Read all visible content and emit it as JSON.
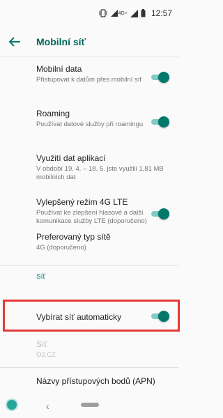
{
  "status_bar": {
    "network": "4G+",
    "time": "12:57"
  },
  "app_bar": {
    "title": "Mobilní síť"
  },
  "settings": {
    "mobile_data": {
      "title": "Mobilní data",
      "summary": "Přistupovat k datům přes mobilní síť",
      "on": true
    },
    "roaming": {
      "title": "Roaming",
      "summary": "Používat datové služby při roamingu",
      "on": true
    },
    "data_usage": {
      "title": "Využití dat aplikací",
      "summary": "V období 19. 4. – 18. 5. jste využili 1,81 MB mobilních dat"
    },
    "lte": {
      "title": "Vylepšený režim 4G LTE",
      "summary": "Používat ke zlepšení hlasové a další komunikace služby LTE (doporučeno)",
      "on": true
    },
    "network_type": {
      "title": "Preferovaný typ sítě",
      "summary": "4G (doporučeno)"
    }
  },
  "network_section": {
    "header": "Síť",
    "auto_select": {
      "title": "Vybírat síť automaticky",
      "on": true
    },
    "network": {
      "title": "Síť",
      "summary": "O2.CZ"
    },
    "apn": {
      "title": "Názvy přístupových bodů (APN)"
    }
  },
  "colors": {
    "accent": "#00796b",
    "highlight": "#e53935"
  }
}
